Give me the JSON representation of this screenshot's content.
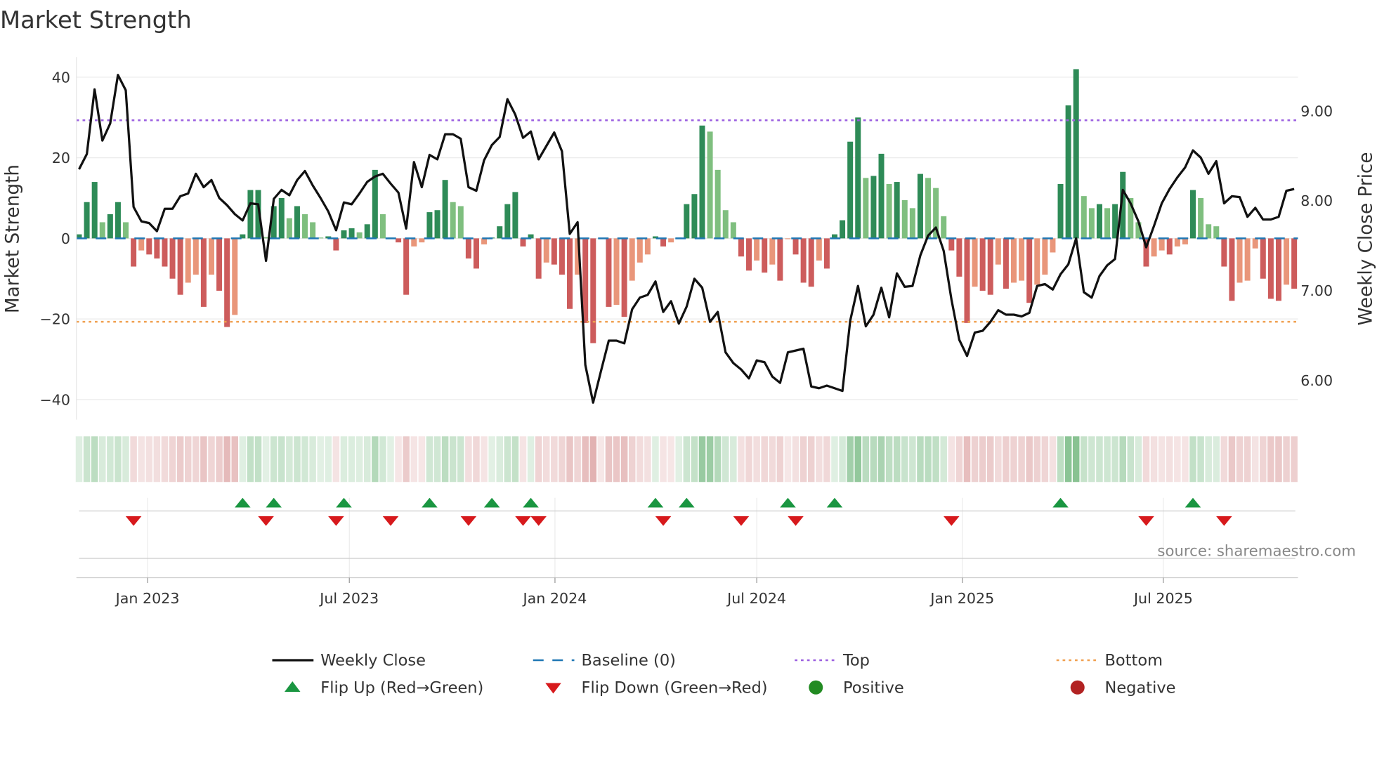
{
  "chart_data": {
    "type": "bar",
    "title": "Market Strength",
    "ylabel": "Market Strength",
    "y2label": "Weekly Close Price",
    "source": "source: sharemaestro.com",
    "ylim": [
      -45,
      45
    ],
    "y2lim": [
      5.56,
      9.6
    ],
    "y_ticks": [
      {
        "v": 40,
        "label": "40"
      },
      {
        "v": 20,
        "label": "20"
      },
      {
        "v": 0,
        "label": "0"
      },
      {
        "v": -20,
        "label": "−20"
      },
      {
        "v": -40,
        "label": "−40"
      }
    ],
    "y2_ticks": [
      {
        "v": 9,
        "label": "9.00"
      },
      {
        "v": 8,
        "label": "8.00"
      },
      {
        "v": 7,
        "label": "7.00"
      },
      {
        "v": 6,
        "label": "6.00"
      }
    ],
    "x_ticks": [
      {
        "label": "Jan 2023",
        "week": 8.8
      },
      {
        "label": "Jul 2023",
        "week": 34.7
      },
      {
        "label": "Jan 2024",
        "week": 61.1
      },
      {
        "label": "Jul 2024",
        "week": 87.0
      },
      {
        "label": "Jan 2025",
        "week": 113.4
      },
      {
        "label": "Jul 2025",
        "week": 139.2
      }
    ],
    "top_level": 29.3,
    "bottom_level": -20.7,
    "baseline": 0,
    "strength": [
      1,
      9,
      14,
      4,
      6,
      9,
      4,
      -7,
      -3,
      -4,
      -5,
      -7,
      -10,
      -14,
      -11,
      -9,
      -17,
      -9,
      -13,
      -22,
      -19,
      1,
      12,
      12,
      0.3,
      8,
      10,
      5,
      8,
      6,
      4,
      0.2,
      0.5,
      -3,
      2,
      2.5,
      1.5,
      3.5,
      17,
      6,
      0.2,
      -1,
      -14,
      -2,
      -1,
      6.5,
      7,
      14.5,
      9,
      8,
      -5,
      -7.5,
      -1.5,
      0.2,
      3,
      8.5,
      11.5,
      -2,
      1,
      -10,
      -6,
      -6.5,
      -9,
      -17.5,
      -9,
      -21,
      -26,
      -0.2,
      -17,
      -16.5,
      -19.5,
      -10.5,
      -6,
      -4,
      0.5,
      -2,
      -1,
      0.2,
      8.5,
      11,
      28,
      26.5,
      17,
      7,
      4,
      -4.5,
      -8,
      -5.5,
      -8.5,
      -6.5,
      -10.5,
      -0.2,
      -4,
      -11,
      -12,
      -5.5,
      -7.5,
      1,
      4.5,
      24,
      30,
      15,
      15.5,
      21,
      13.5,
      14,
      9.5,
      7.5,
      16,
      15,
      12.5,
      5.5,
      -3,
      -9.5,
      -21,
      -12,
      -13,
      -14,
      -6.5,
      -12.5,
      -11,
      -10.5,
      -16,
      -11.5,
      -9,
      -3.5,
      13.5,
      33,
      42,
      10.5,
      7.5,
      8.5,
      7.5,
      8.5,
      16.5,
      10,
      4,
      -7,
      -4.5,
      -3,
      -4,
      -2,
      -1.5,
      12,
      10,
      3.5,
      3,
      -7,
      -15.5,
      -11,
      -10.5,
      -2.5,
      -10,
      -15,
      -15.5,
      -11.5,
      -12.5
    ],
    "close": [
      8.35,
      8.52,
      9.24,
      8.67,
      8.86,
      9.4,
      9.23,
      7.93,
      7.77,
      7.75,
      7.66,
      7.91,
      7.91,
      8.05,
      8.08,
      8.3,
      8.15,
      8.23,
      8.03,
      7.95,
      7.85,
      7.78,
      7.97,
      7.96,
      7.33,
      8.02,
      8.12,
      8.06,
      8.23,
      8.33,
      8.17,
      8.03,
      7.88,
      7.67,
      7.98,
      7.96,
      8.08,
      8.21,
      8.27,
      8.3,
      8.19,
      8.09,
      7.69,
      8.43,
      8.15,
      8.51,
      8.46,
      8.74,
      8.74,
      8.69,
      8.15,
      8.11,
      8.45,
      8.62,
      8.71,
      9.13,
      8.96,
      8.7,
      8.77,
      8.46,
      8.61,
      8.76,
      8.55,
      7.63,
      7.76,
      6.17,
      5.75,
      6.1,
      6.44,
      6.44,
      6.41,
      6.79,
      6.92,
      6.95,
      7.1,
      6.76,
      6.88,
      6.63,
      6.82,
      7.13,
      7.03,
      6.65,
      6.76,
      6.31,
      6.19,
      6.12,
      6.02,
      6.22,
      6.2,
      6.04,
      5.97,
      6.31,
      6.33,
      6.35,
      5.93,
      5.91,
      5.94,
      5.91,
      5.88,
      6.66,
      7.05,
      6.6,
      6.73,
      7.03,
      6.7,
      7.19,
      7.04,
      7.05,
      7.39,
      7.61,
      7.7,
      7.44,
      6.9,
      6.45,
      6.27,
      6.53,
      6.55,
      6.65,
      6.78,
      6.73,
      6.73,
      6.71,
      6.75,
      7.05,
      7.07,
      7.01,
      7.18,
      7.29,
      7.58,
      6.98,
      6.92,
      7.16,
      7.28,
      7.35,
      8.12,
      7.97,
      7.77,
      7.48,
      7.72,
      7.97,
      8.13,
      8.26,
      8.37,
      8.56,
      8.48,
      8.3,
      8.44,
      7.97,
      8.05,
      8.04,
      7.82,
      7.92,
      7.79,
      7.79,
      7.82,
      8.11,
      8.13
    ],
    "flip_up_weeks": [
      21,
      25,
      34,
      45,
      53,
      58,
      74,
      78,
      91,
      97,
      126,
      143
    ],
    "flip_down_weeks": [
      7,
      24,
      33,
      40,
      50,
      57,
      59,
      75,
      85,
      92,
      112,
      137,
      147
    ],
    "legend": [
      {
        "label": "Weekly Close",
        "kind": "line"
      },
      {
        "label": "Baseline (0)",
        "kind": "dash"
      },
      {
        "label": "Top",
        "kind": "dot-top"
      },
      {
        "label": "Bottom",
        "kind": "dot-bottom"
      },
      {
        "label": "Flip Up (Red→Green)",
        "kind": "tri-up"
      },
      {
        "label": "Flip Down (Green→Red)",
        "kind": "tri-down"
      },
      {
        "label": "Positive",
        "kind": "circle-pos"
      },
      {
        "label": "Negative",
        "kind": "circle-neg"
      }
    ],
    "colors": {
      "pos_dark": "#2e8b57",
      "pos_light": "#7fbf7f",
      "neg_dark": "#cd5c5c",
      "neg_light": "#e9967a",
      "baseline": "#1f77b4",
      "top": "#9b5fe0",
      "bottom": "#f0a050",
      "up": "#1a9641",
      "down": "#d7191c",
      "close": "#111111"
    }
  }
}
